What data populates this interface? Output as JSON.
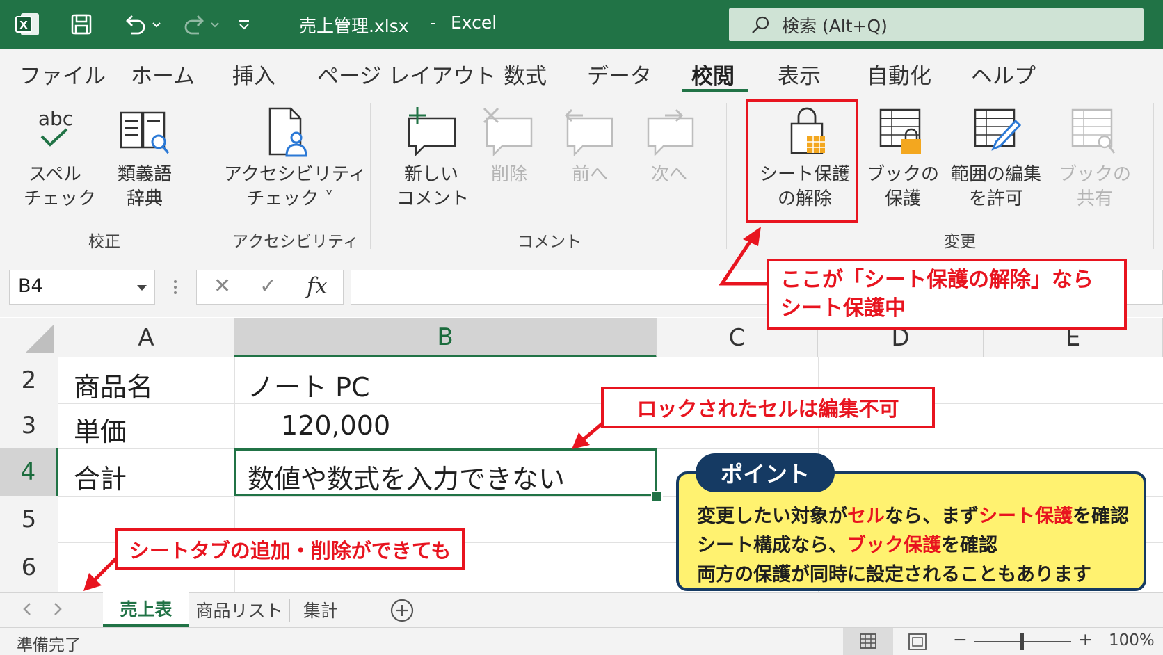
{
  "titlebar": {
    "filename": "売上管理.xlsx",
    "separator": "-",
    "app": "Excel",
    "search_placeholder": "検索 (Alt+Q)"
  },
  "ribbon_tabs": [
    "ファイル",
    "ホーム",
    "挿入",
    "ページ レイアウト",
    "数式",
    "データ",
    "校閲",
    "表示",
    "自動化",
    "ヘルプ"
  ],
  "active_tab": "校閲",
  "ribbon": {
    "proofing": {
      "spell_l1": "スペル",
      "spell_l2": "チェック",
      "thes_l1": "類義語",
      "thes_l2": "辞典",
      "group": "校正"
    },
    "accessibility": {
      "l1": "アクセシビリティ",
      "l2": "チェック ˅",
      "group": "アクセシビリティ"
    },
    "comments": {
      "new_l1": "新しい",
      "new_l2": "コメント",
      "delete": "削除",
      "prev": "前へ",
      "next": "次へ",
      "group": "コメント"
    },
    "changes": {
      "unprotect_l1": "シート保護",
      "unprotect_l2": "の解除",
      "protect_book_l1": "ブックの",
      "protect_book_l2": "保護",
      "allow_edit_l1": "範囲の編集",
      "allow_edit_l2": "を許可",
      "share_l1": "ブックの",
      "share_l2": "共有",
      "group": "変更"
    }
  },
  "formula_bar": {
    "name_box": "B4",
    "cancel": "✕",
    "enter": "✓",
    "fx": "fx",
    "value": ""
  },
  "columns": [
    "A",
    "B",
    "C",
    "D",
    "E"
  ],
  "rows": [
    {
      "num": "2",
      "a": "商品名",
      "b": "ノート PC"
    },
    {
      "num": "3",
      "a": "単価",
      "b": "120,000"
    },
    {
      "num": "4",
      "a": "合計",
      "b": "数値や数式を入力できない"
    },
    {
      "num": "5",
      "a": "",
      "b": ""
    },
    {
      "num": "6",
      "a": "",
      "b": ""
    }
  ],
  "sheet_tabs": [
    "売上表",
    "商品リスト",
    "集計"
  ],
  "active_sheet": "売上表",
  "status": {
    "ready": "準備完了",
    "zoom": "100%",
    "minus": "−",
    "plus": "+"
  },
  "annotations": {
    "unprotect_note_l1": "ここが「シート保護の解除」なら",
    "unprotect_note_l2": "シート保護中",
    "locked_note": "ロックされたセルは編集不可",
    "tab_note": "シートタブの追加・削除ができても",
    "point_title": "ポイント",
    "point_l1_a": "変更したい対象が",
    "point_l1_b": "セル",
    "point_l1_c": "なら、まず",
    "point_l1_d": "シート保護",
    "point_l1_e": "を確認",
    "point_l2_a": "シート構成なら、",
    "point_l2_b": "ブック保護",
    "point_l2_c": "を確認",
    "point_l3": "両方の保護が同時に設定されることもあります"
  },
  "colors": {
    "excel_green": "#217346",
    "callout_red": "#e8141f",
    "point_yellow": "#fff270",
    "point_navy": "#153a63"
  }
}
